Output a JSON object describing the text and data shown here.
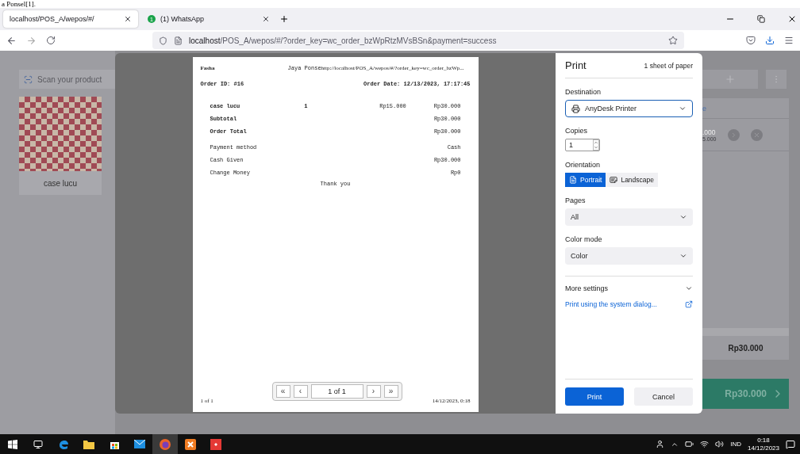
{
  "doc_strip": {
    "text": "a Ponsel[1]."
  },
  "browser": {
    "tabs": [
      {
        "title": "localhost/POS_A/wepos/#/",
        "selected": true
      },
      {
        "title": "(1) WhatsApp",
        "badge": "1",
        "selected": false
      }
    ],
    "url": {
      "host": "localhost",
      "path": "/POS_A/wepos/#/?order_key=wc_order_bzWpRtzMVsBSn&payment=success"
    }
  },
  "pos_left": {
    "search_placeholder": "Scan your product",
    "product": {
      "name": "case lucu"
    }
  },
  "pos_right": {
    "cart_header": "e",
    "item_price": ".000",
    "item_subprice": "5.000",
    "total": "Rp30.000",
    "pay_button": "Rp30.000"
  },
  "preview": {
    "site": "Fasha",
    "shop": "Jaya Ponse",
    "url": "http://localhost/POS_A/wepos/#/?order_key=wc_order_bzWp...",
    "order_id": "Order ID: #16",
    "order_date": "Order Date: 12/13/2023, 17:17:45",
    "items": [
      {
        "name": "case lucu",
        "qty": "1",
        "price": "Rp15.000",
        "total": "Rp30.000"
      }
    ],
    "totals": [
      {
        "label": "Subtotal",
        "value": "Rp30.000"
      },
      {
        "label": "Order Total",
        "value": "Rp30.000"
      }
    ],
    "payment": [
      {
        "label": "Payment method",
        "value": "Cash"
      },
      {
        "label": "Cash Given",
        "value": "Rp30.000"
      },
      {
        "label": "Change Money",
        "value": "Rp0"
      }
    ],
    "thanks": "Thank you",
    "footer_left": "1 of 1",
    "footer_right": "14/12/2023, 0:18",
    "pager": {
      "first": "«",
      "prev": "‹",
      "page": "1 of 1",
      "next": "›",
      "last": "»"
    }
  },
  "print": {
    "title": "Print",
    "sheets": "1 sheet of paper",
    "destination": {
      "label": "Destination",
      "value": "AnyDesk Printer"
    },
    "copies": {
      "label": "Copies",
      "value": "1"
    },
    "orientation": {
      "label": "Orientation",
      "options": [
        {
          "label": "Portrait",
          "selected": true
        },
        {
          "label": "Landscape",
          "selected": false
        }
      ]
    },
    "pages": {
      "label": "Pages",
      "value": "All"
    },
    "color_mode": {
      "label": "Color mode",
      "value": "Color"
    },
    "more_settings": "More settings",
    "system_dialog": "Print using the system dialog...",
    "buttons": [
      {
        "label": "Print",
        "kind": "primary"
      },
      {
        "label": "Cancel",
        "kind": "secondary"
      }
    ]
  },
  "taskbar": {
    "apps": [
      {
        "kind": "windows"
      },
      {
        "kind": "taskview"
      },
      {
        "kind": "edge"
      },
      {
        "kind": "folder"
      },
      {
        "kind": "store"
      },
      {
        "kind": "mail"
      },
      {
        "kind": "firefox",
        "selected": true
      },
      {
        "kind": "xampp"
      },
      {
        "kind": "anydesk"
      }
    ],
    "lang": "IND",
    "time": "0:18",
    "date": "14/12/2023"
  }
}
